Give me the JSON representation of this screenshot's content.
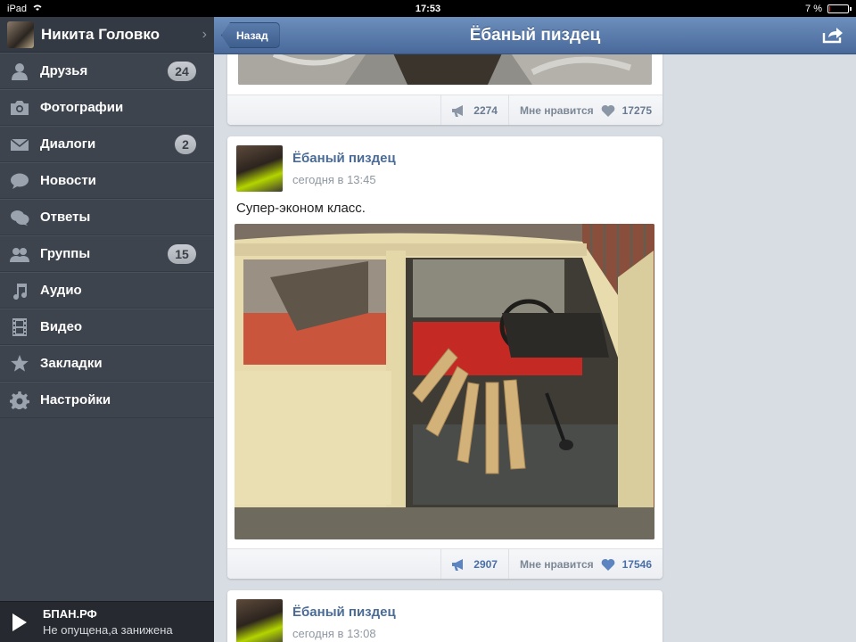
{
  "statusbar": {
    "device": "iPad",
    "time": "17:53",
    "battery_text": "7 %",
    "battery_level_pct": 7
  },
  "sidebar": {
    "profile_name": "Никита Головко",
    "items": [
      {
        "label": "Друзья",
        "icon": "person-icon",
        "badge": "24"
      },
      {
        "label": "Фотографии",
        "icon": "camera-icon",
        "badge": null
      },
      {
        "label": "Диалоги",
        "icon": "envelope-icon",
        "badge": "2"
      },
      {
        "label": "Новости",
        "icon": "speech-bubble-icon",
        "badge": null
      },
      {
        "label": "Ответы",
        "icon": "chat-bubbles-icon",
        "badge": null
      },
      {
        "label": "Группы",
        "icon": "people-icon",
        "badge": "15"
      },
      {
        "label": "Аудио",
        "icon": "music-note-icon",
        "badge": null
      },
      {
        "label": "Видео",
        "icon": "film-icon",
        "badge": null
      },
      {
        "label": "Закладки",
        "icon": "star-icon",
        "badge": null
      },
      {
        "label": "Настройки",
        "icon": "gear-icon",
        "badge": null
      }
    ],
    "player": {
      "artist": "БПАН.РФ",
      "track": "Не опущена,а занижена"
    }
  },
  "header": {
    "back_label": "Назад",
    "title": "Ёбаный пиздец"
  },
  "feed": {
    "post0": {
      "reposts": "2274",
      "like_label": "Мне нравится",
      "likes": "17275"
    },
    "post1": {
      "author": "Ёбаный пиздец",
      "time": "сегодня в 13:45",
      "text": "Супер-эконом класс.",
      "reposts": "2907",
      "like_label": "Мне нравится",
      "likes": "17546"
    },
    "post2": {
      "author": "Ёбаный пиздец",
      "time": "сегодня в 13:08"
    }
  },
  "colors": {
    "header_blue": "#5679ab",
    "sidebar_bg": "#3e444e",
    "link_blue": "#4a6b96",
    "like_active": "#5b84c0"
  }
}
